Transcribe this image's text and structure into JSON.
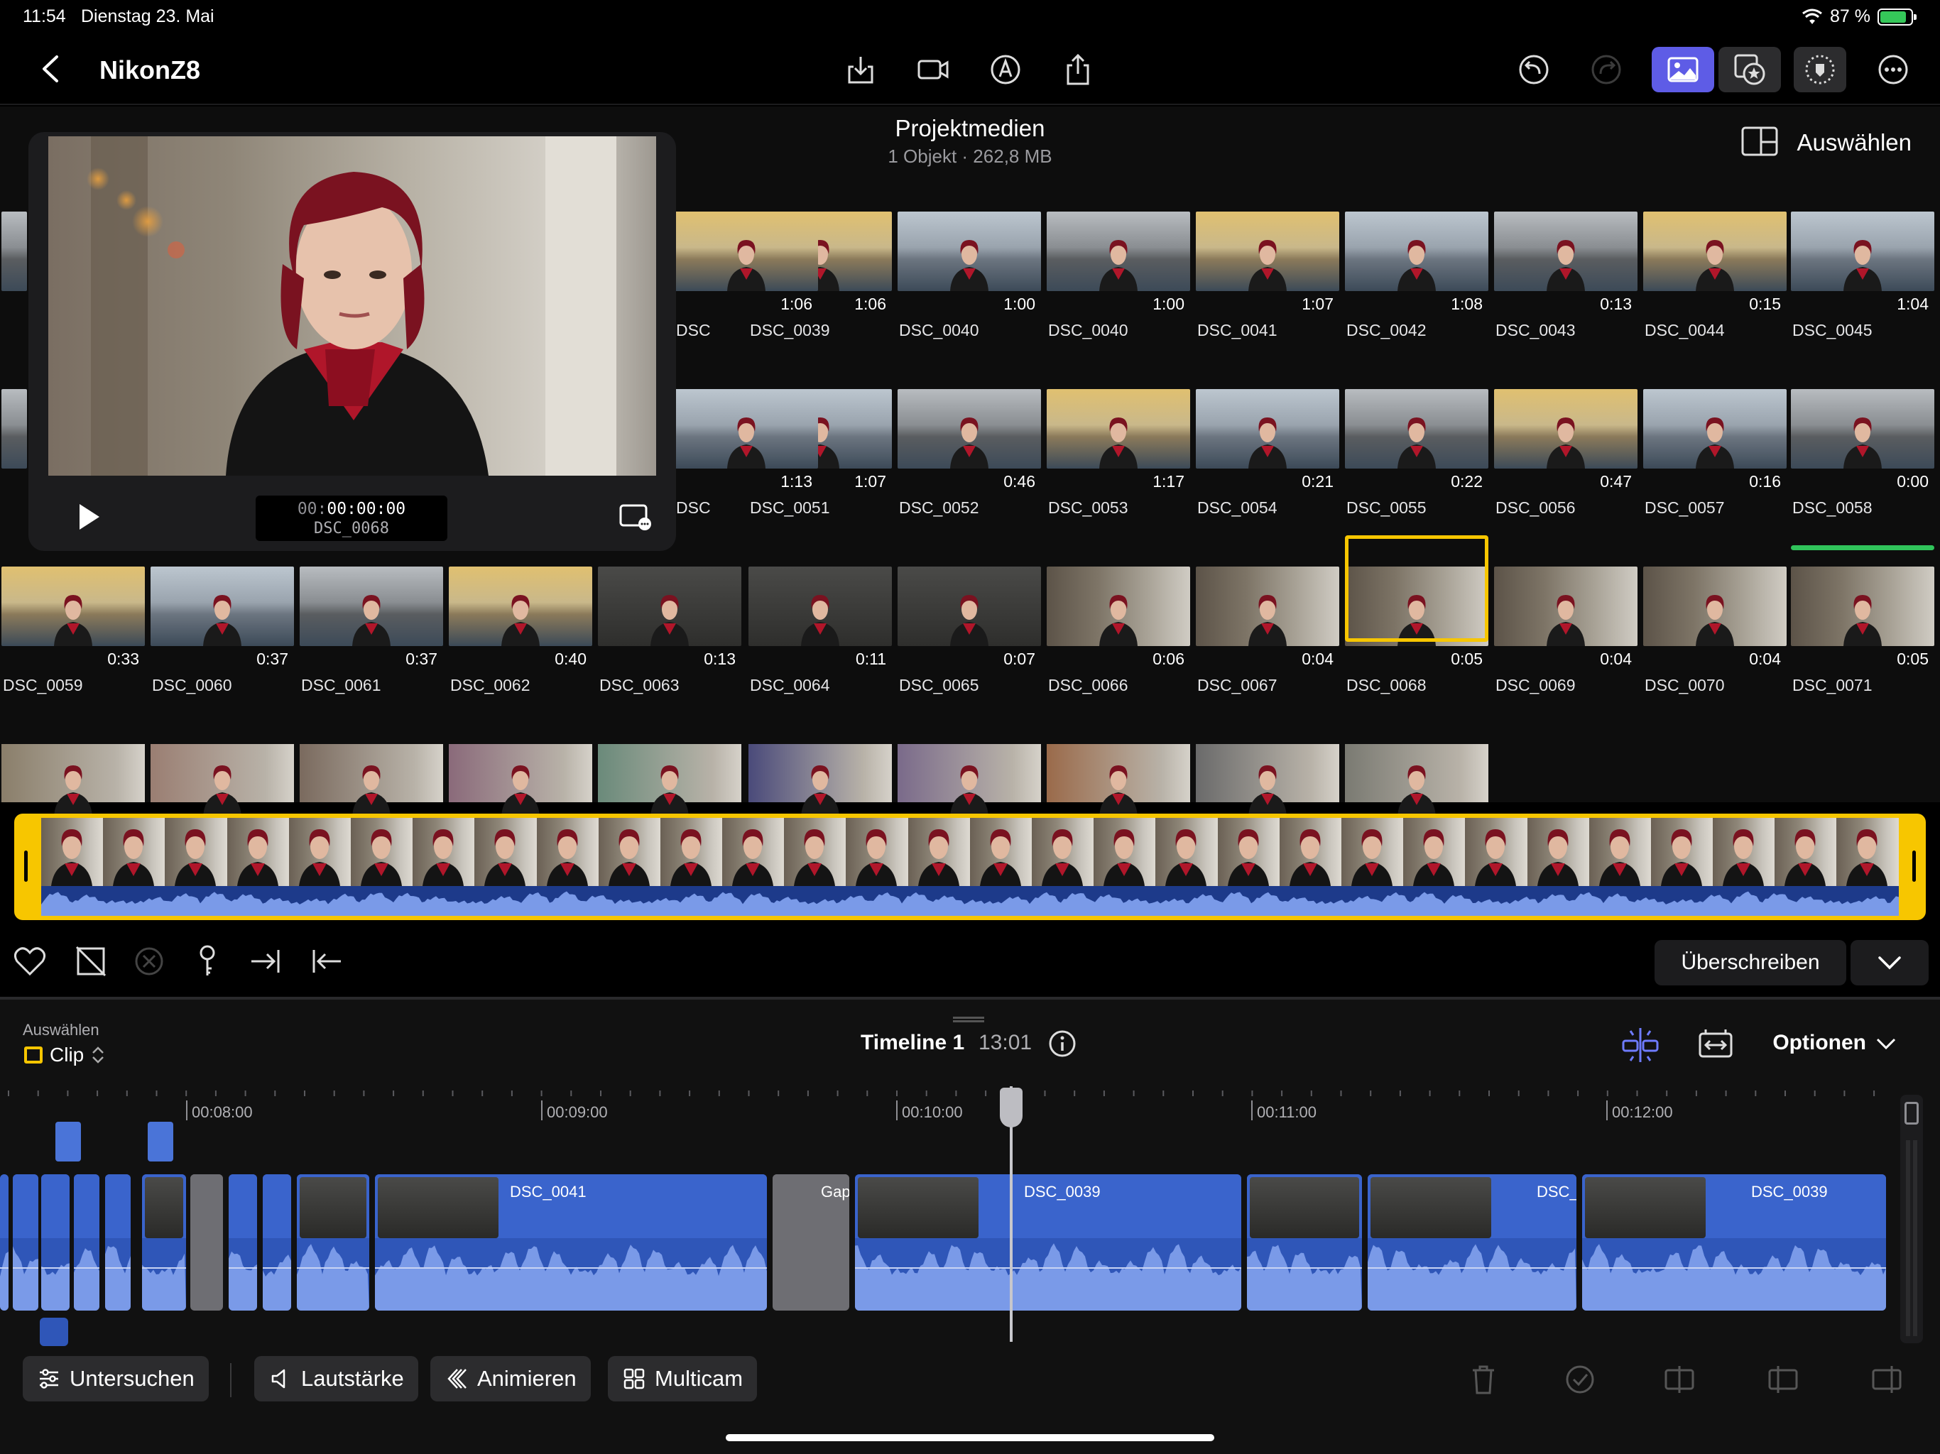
{
  "status": {
    "time": "11:54",
    "date": "Dienstag 23. Mai",
    "battery": "87 %"
  },
  "toolbar": {
    "title": "NikonZ8",
    "icons": [
      "back-icon",
      "import-icon",
      "camera-icon",
      "voiceover-icon",
      "share-icon",
      "undo-icon",
      "redo-icon",
      "photos-icon",
      "effects-icon",
      "inspector-icon",
      "more-icon"
    ]
  },
  "browser": {
    "title": "Projektmedien",
    "subtitle": "1 Objekt  ·  262,8 MB",
    "select_label": "Auswählen",
    "rows": [
      [
        {
          "dur": "1:06",
          "name": "DSC_0039"
        },
        {
          "dur": "1:00",
          "name": "DSC_0040"
        },
        {
          "dur": "1:00",
          "name": "DSC_0040"
        },
        {
          "dur": "1:07",
          "name": "DSC_0041"
        },
        {
          "dur": "1:08",
          "name": "DSC_0042"
        },
        {
          "dur": "0:13",
          "name": "DSC_0043"
        },
        {
          "dur": "0:15",
          "name": "DSC_0044"
        },
        {
          "dur": "1:04",
          "name": "DSC_0045"
        }
      ],
      [
        {
          "dur": "1:07",
          "name": "DSC_0051"
        },
        {
          "dur": "0:46",
          "name": "DSC_0052"
        },
        {
          "dur": "1:17",
          "name": "DSC_0053"
        },
        {
          "dur": "0:21",
          "name": "DSC_0054"
        },
        {
          "dur": "0:22",
          "name": "DSC_0055"
        },
        {
          "dur": "0:47",
          "name": "DSC_0056"
        },
        {
          "dur": "0:16",
          "name": "DSC_0057"
        },
        {
          "dur": "0:00",
          "name": "DSC_0058"
        }
      ],
      [
        {
          "dur": "0:33",
          "name": "DSC_0059"
        },
        {
          "dur": "0:37",
          "name": "DSC_0060"
        },
        {
          "dur": "0:37",
          "name": "DSC_0061"
        },
        {
          "dur": "0:40",
          "name": "DSC_0062"
        },
        {
          "dur": "0:13",
          "name": "DSC_0063"
        },
        {
          "dur": "0:11",
          "name": "DSC_0064"
        },
        {
          "dur": "0:07",
          "name": "DSC_0065"
        },
        {
          "dur": "0:06",
          "name": "DSC_0066"
        },
        {
          "dur": "0:04",
          "name": "DSC_0067"
        },
        {
          "dur": "0:05",
          "name": "DSC_0068"
        },
        {
          "dur": "0:04",
          "name": "DSC_0069"
        },
        {
          "dur": "0:04",
          "name": "DSC_0070"
        },
        {
          "dur": "0:05",
          "name": "DSC_0071"
        }
      ]
    ],
    "partial_left": {
      "row1": {
        "dur": "1:06",
        "name": "DSC"
      },
      "row2": {
        "dur": "1:13",
        "name": "DSC"
      }
    }
  },
  "viewer": {
    "timecode_dim": "00:",
    "timecode_bright": "00:00:00",
    "clip_name": "DSC_0068"
  },
  "clip_actions": {
    "overwrite_label": "Überschreiben"
  },
  "timeline": {
    "select_label": "Auswählen",
    "mode_label": "Clip",
    "title": "Timeline 1",
    "duration": "13:01",
    "options_label": "Optionen",
    "ruler": [
      "00:08:00",
      "00:09:00",
      "00:10:00",
      "00:11:00",
      "00:12:00"
    ],
    "clips": {
      "c1": "DSC_0041",
      "gap": "Gap",
      "c2": "DSC_0039",
      "c3": "DSC_",
      "c4": "DSC_0039"
    }
  },
  "bottom": {
    "inspect": "Untersuchen",
    "volume": "Lautstärke",
    "animate": "Animieren",
    "multicam": "Multicam"
  },
  "colors": {
    "accent": "#5e5ce6",
    "selection": "#f7c600",
    "clip_blue": "#2f56b8",
    "favorite_green": "#30c35a"
  }
}
